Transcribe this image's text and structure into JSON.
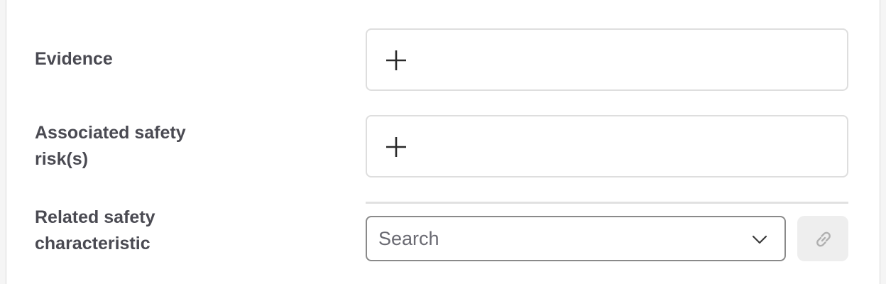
{
  "fields": {
    "evidence": {
      "label": "Evidence",
      "add_icon": "plus-icon"
    },
    "associated_risks": {
      "label_line1": "Associated safety",
      "label_line2": "risk(s)",
      "add_icon": "plus-icon"
    },
    "related_characteristic": {
      "label_line1": "Related safety",
      "label_line2": "characteristic",
      "search_placeholder": "Search",
      "search_value": "",
      "dropdown_icon": "chevron-down-icon",
      "link_icon": "link-icon"
    }
  },
  "colors": {
    "label": "#4a4a52",
    "box_border": "#dedede",
    "select_border": "#8a8a8a",
    "link_button_bg": "#eeeeee",
    "link_icon": "#b0b0b0"
  }
}
